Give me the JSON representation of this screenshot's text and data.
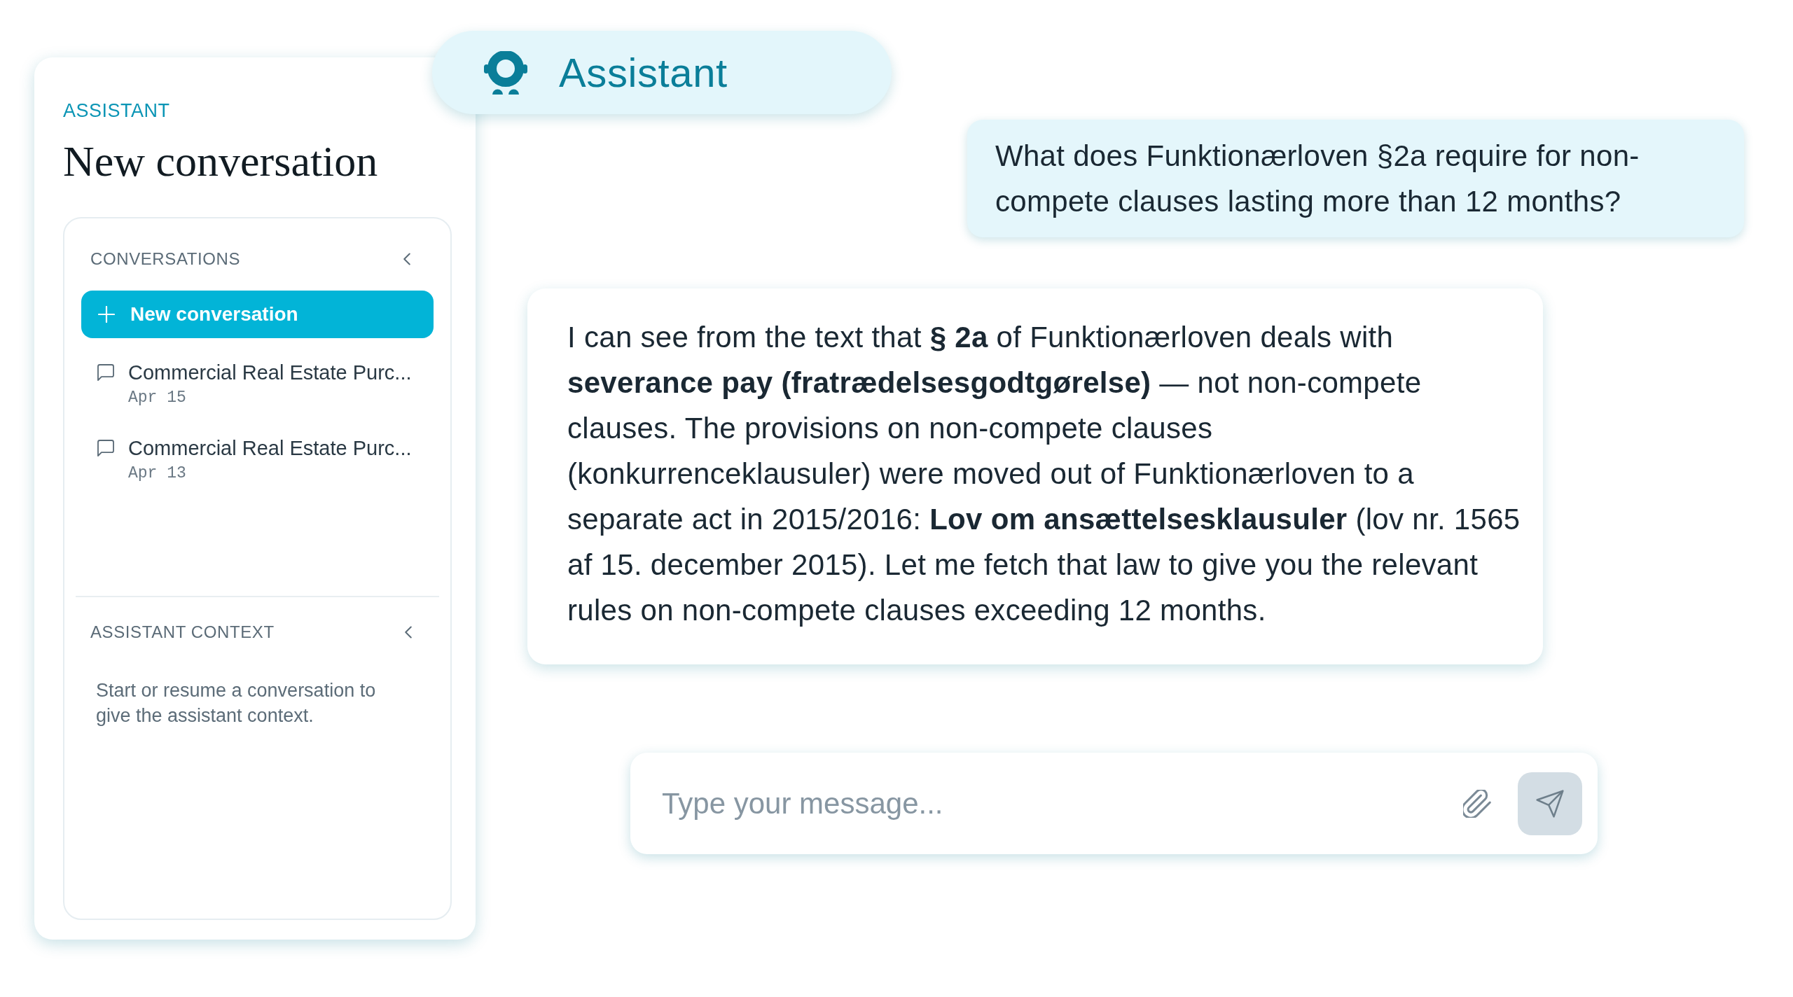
{
  "header": {
    "title": "Assistant"
  },
  "sidebar": {
    "eyebrow": "ASSISTANT",
    "title": "New conversation",
    "conversations": {
      "heading": "CONVERSATIONS",
      "new_button": "New conversation",
      "items": [
        {
          "title": "Commercial Real Estate Purc...",
          "date": "Apr 15",
          "selected": false
        },
        {
          "title": "Commercial Real Estate Purc...",
          "date": "Apr 13",
          "selected": false
        }
      ]
    },
    "context": {
      "heading": "ASSISTANT CONTEXT",
      "text": "Start or resume a conversation to give the assistant context."
    }
  },
  "messages": [
    {
      "kind": "user",
      "text": "What does Funktionærloven §2a require for non-compete clauses lasting more than 12 months?"
    },
    {
      "kind": "assistant",
      "text": "I can see from the text that **§ 2a** of Funktionærloven deals with **severance pay (fratrædelsesgodtgørelse)** — not non-compete clauses. The provisions on non-compete clauses (konkurrenceklausuler) were moved out of Funktionærloven to a separate act in 2015/2016: **Lov om ansættelsesklausuler** (lov nr. 1565 af 15. december 2015). Let me fetch that law to give you the relevant rules on non-compete clauses exceeding 12 months."
    }
  ],
  "composer": {
    "placeholder": "Type your message...",
    "send_disabled": true
  }
}
